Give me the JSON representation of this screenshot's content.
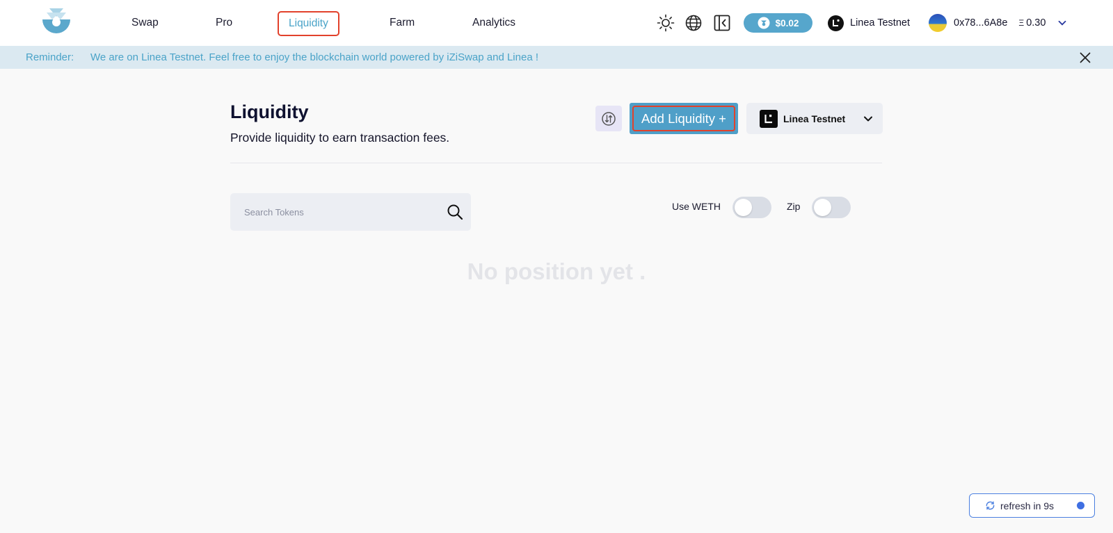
{
  "colors": {
    "accent": "#4aa3c8",
    "highlight_border": "#e2412b",
    "button_bg": "#4f9fc8",
    "banner_bg": "#dbe9f1"
  },
  "header": {
    "logo_icon": "iziswap-logo-icon",
    "nav": [
      {
        "label": "Swap"
      },
      {
        "label": "Pro"
      },
      {
        "label": "Liquidity",
        "active": true
      },
      {
        "label": "Farm"
      },
      {
        "label": "Analytics"
      }
    ],
    "icons": [
      "sun-icon",
      "globe-icon",
      "sidebar-collapse-icon"
    ],
    "token_price": "$0.02",
    "network_name": "Linea Testnet",
    "account_address": "0x78...6A8e",
    "balance_symbol": "Ξ",
    "balance_value": "0.30"
  },
  "banner": {
    "label": "Reminder:",
    "message": "We are on Linea Testnet. Feel free to enjoy the blockchain world powered by iZiSwap and Linea !"
  },
  "main": {
    "title": "Liquidity",
    "subtitle": "Provide liquidity to earn transaction fees.",
    "add_button": "Add Liquidity +",
    "chain_select": "Linea Testnet",
    "search_placeholder": "Search Tokens",
    "toggles": [
      {
        "label": "Use WETH",
        "on": false
      },
      {
        "label": "Zip",
        "on": false
      }
    ],
    "empty_text": "No position yet ."
  },
  "refresh": {
    "label": "refresh in 9s"
  }
}
